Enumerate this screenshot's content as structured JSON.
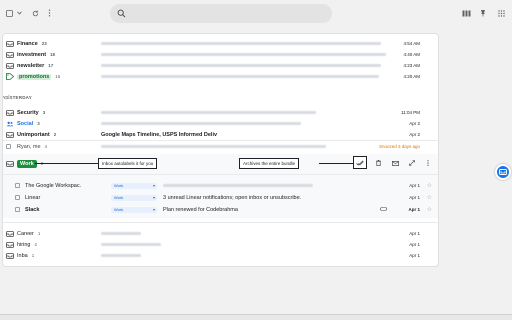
{
  "topbar": {
    "icons": [
      "checkbox-icon",
      "chevron-down-icon",
      "refresh-icon",
      "more-icon",
      "search-icon",
      "columns-icon",
      "pin-icon",
      "apps-icon"
    ]
  },
  "bundles_top": [
    {
      "label": "Finance",
      "count": "23",
      "time": "4:54 AM"
    },
    {
      "label": "investment",
      "count": "18",
      "time": "4:40 AM"
    },
    {
      "label": "newsletter",
      "count": "17",
      "time": "4:23 AM"
    },
    {
      "label": "promotions",
      "count": "16",
      "time": "4:20 AM"
    }
  ],
  "section_label": "YESTERDAY",
  "bundles_yesterday": [
    {
      "label": "Security",
      "count": "3",
      "time": "11:04 PM"
    },
    {
      "label": "Social",
      "count": "3",
      "time": "Apr 2"
    },
    {
      "label": "Unimportant",
      "count": "2",
      "subject": "Google Maps Timeline, USPS Informed Deliv",
      "time": "Apr 2"
    }
  ],
  "snoozed_row": {
    "sender": "Ryan, me",
    "count": "4",
    "status": "Snoozed 3 days ago"
  },
  "work_bundle": {
    "label": "Work",
    "count": "3",
    "callout_left": "Inbox autolabels it for you",
    "callout_right": "Archives the entire bundle",
    "emails": [
      {
        "sender": "The Google Workspac.",
        "tag": "Work",
        "subject": "",
        "time": "Apr 1",
        "bold": false
      },
      {
        "sender": "Linear",
        "tag": "Work",
        "subject": "3 unread Linear notifications; open inbox or unsubscribe.",
        "time": "Apr 1",
        "bold": false
      },
      {
        "sender": "Slack",
        "tag": "Work",
        "subject": "Plan renewed for Codebrahma",
        "time": "Apr 1",
        "bold": true
      }
    ]
  },
  "bundles_bottom": [
    {
      "label": "Career",
      "count": "1",
      "time": "Apr 1"
    },
    {
      "label": "hiring",
      "count": "2",
      "time": "Apr 1"
    },
    {
      "label": "Inba",
      "count": "1",
      "time": "Apr 1"
    }
  ],
  "colors": {
    "accent": "#1a73e8",
    "work_green": "#1e8e3e",
    "promo_green": "#137333",
    "snoozed": "#e37400"
  }
}
